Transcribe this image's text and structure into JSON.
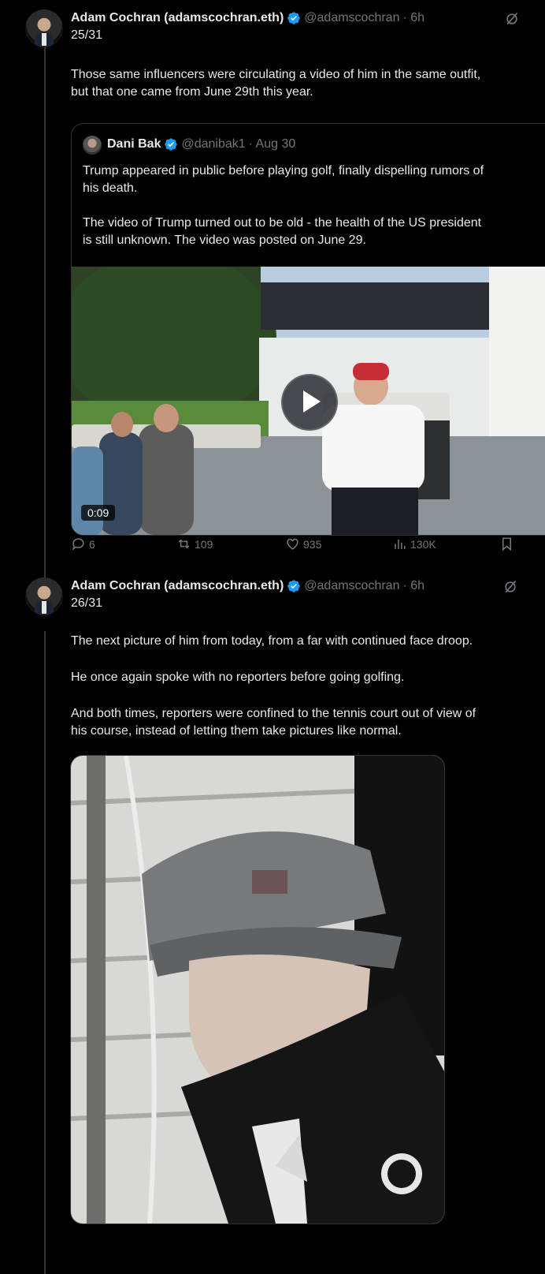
{
  "tweets": [
    {
      "author": "Adam Cochran (adamscochran.eth)",
      "handle": "@adamscochran",
      "time": "· 6h",
      "counter": "25/31",
      "lines": [
        "Those same influencers were circulating a video of him in the same outfit,",
        "but that one came from June 29th this year."
      ],
      "quote": {
        "author": "Dani Bak",
        "handle": "@danibak1",
        "time": "· Aug 30",
        "lines": [
          "Trump appeared in public before playing golf, finally dispelling rumors of",
          "his death.",
          "",
          "The video of Trump turned out to be old - the health of the US president",
          "is still unknown. The video was posted on June 29."
        ],
        "duration": "0:09"
      },
      "actions": {
        "replies": "6",
        "reposts": "109",
        "likes": "935",
        "views": "130K"
      }
    },
    {
      "author": "Adam Cochran (adamscochran.eth)",
      "handle": "@adamscochran",
      "time": "· 6h",
      "counter": "26/31",
      "lines": [
        "The next picture of him from today, from a far with continued face droop.",
        "",
        "He once again spoke with no reporters before going golfing.",
        "",
        "And both times, reporters were confined to the tennis court out of view of",
        "his course, instead of letting them take pictures like normal."
      ]
    }
  ],
  "colors": {
    "background": "#000000",
    "text": "#e7e9ea",
    "muted": "#71767b",
    "verified": "#1d9bf0",
    "border": "#2f3336"
  }
}
